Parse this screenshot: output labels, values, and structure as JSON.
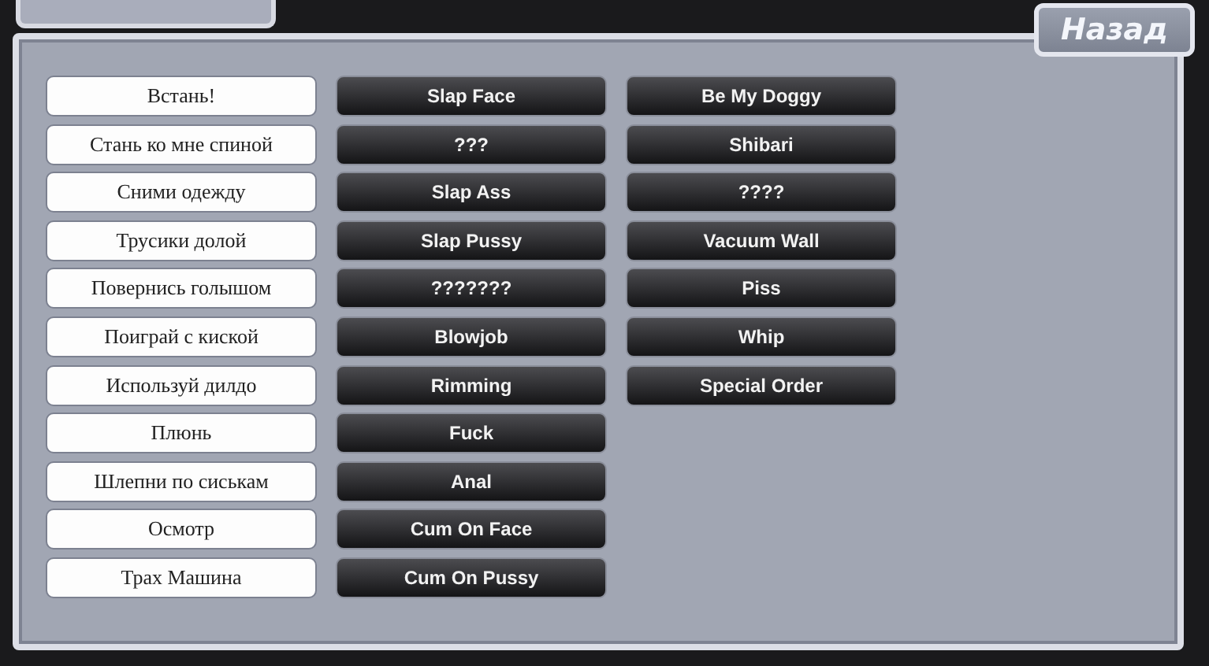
{
  "back_button": {
    "label": "Назад"
  },
  "commands": [
    "Встань!",
    "Стань ко мне спиной",
    "Сними одежду",
    "Трусики долой",
    "Повернись голышом",
    "Поиграй с киской",
    "Используй дилдо",
    "Плюнь",
    "Шлепни по сиськам",
    "Осмотр",
    "Трах Машина"
  ],
  "actions_1": [
    "Slap Face",
    "???",
    "Slap Ass",
    "Slap Pussy",
    "???????",
    "Blowjob",
    "Rimming",
    "Fuck",
    "Anal",
    "Cum On Face",
    "Cum On Pussy"
  ],
  "actions_2": [
    "Be My Doggy",
    "Shibari",
    "????",
    "Vacuum Wall",
    "Piss",
    "Whip",
    "Special Order"
  ]
}
